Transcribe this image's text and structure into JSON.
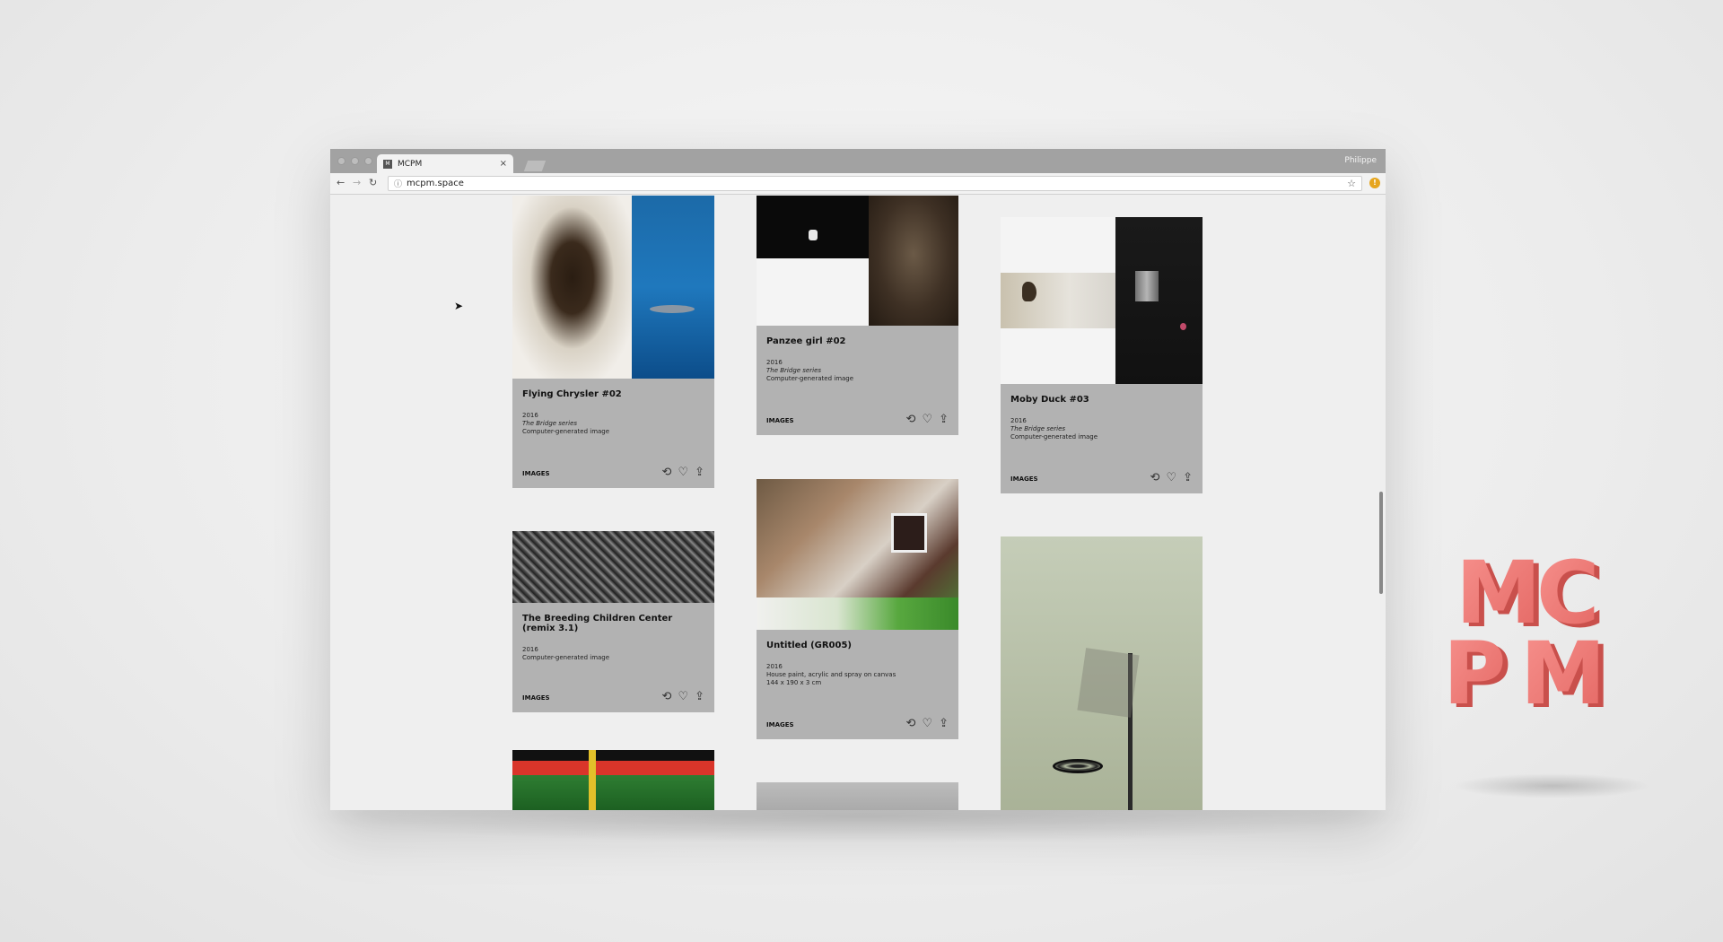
{
  "browser": {
    "tab_title": "MCPM",
    "tab_close": "×",
    "profile_name": "Philippe",
    "url": "mcpm.space",
    "ext_badge": "!"
  },
  "icons": {
    "back": "arrow-left-icon",
    "forward": "arrow-right-icon",
    "reload": "reload-icon",
    "info": "info-icon",
    "star": "bookmark-star-icon",
    "repost": "repost-icon",
    "like": "heart-icon",
    "share": "share-icon",
    "cursor": "mouse-cursor-icon"
  },
  "cards": [
    {
      "title": "Flying Chrysler #02",
      "year": "2016",
      "series": "The Bridge series",
      "medium": "Computer-generated image",
      "dimensions": "",
      "category": "IMAGES"
    },
    {
      "title": "Panzee girl #02",
      "year": "2016",
      "series": "The Bridge series",
      "medium": "Computer-generated image",
      "dimensions": "",
      "category": "IMAGES"
    },
    {
      "title": "Moby Duck #03",
      "year": "2016",
      "series": "The Bridge series",
      "medium": "Computer-generated image",
      "dimensions": "",
      "category": "IMAGES"
    },
    {
      "title": "The Breeding Children Center (remix 3.1)",
      "year": "2016",
      "series": "",
      "medium": "Computer-generated image",
      "dimensions": "",
      "category": "IMAGES"
    },
    {
      "title": "Untitled (GR005)",
      "year": "2016",
      "series": "",
      "medium": "House paint, acrylic and spray on canvas",
      "dimensions": "144 x 190 x 3 cm",
      "category": "IMAGES"
    }
  ],
  "logo_letters": [
    "M",
    "C",
    "P",
    "M"
  ],
  "colors": {
    "card_bg": "#b2b2b2",
    "page_bg": "#efefef",
    "logo": "#f07c7a"
  }
}
